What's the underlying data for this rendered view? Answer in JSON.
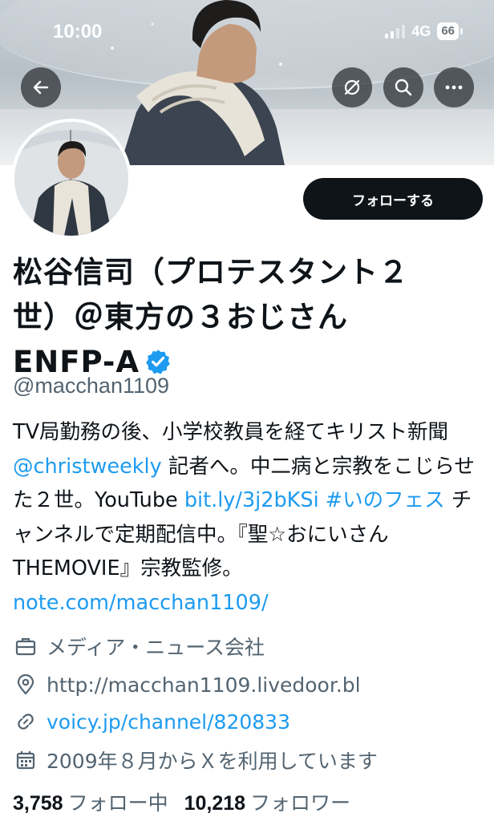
{
  "status_bar": {
    "time": "10:00",
    "network": "4G",
    "battery": "66"
  },
  "banner": {
    "back_icon": "arrow-left-icon",
    "hide_icon": "eye-slash-icon",
    "search_icon": "search-icon",
    "more_icon": "more-horizontal-icon"
  },
  "profile": {
    "follow_label": "フォローする",
    "name_line1": "松谷信司（プロテスタント２",
    "name_line2": "世）＠東方の３おじさん",
    "name_line3": "ENFP-A",
    "handle": "@macchan1109",
    "bio": {
      "t1": "TV局勤務の後、小学校教員を経てキリスト新聞 ",
      "mention": "@christweekly",
      "t2": " 記者へ。中二病と宗教をこじらせた２世。YouTube ",
      "link1": "bit.ly/3j2bKSi",
      "t3": " ",
      "hashtag": "#いのフェス",
      "t4": " チャンネルで定期配信中。『聖☆おにいさん THEMOVIE』宗教監修。",
      "link2": "note.com/macchan1109/"
    },
    "category": "メディア・ニュース会社",
    "location": "http://macchan1109.livedoor.bl",
    "website": "voicy.jp/channel/820833",
    "joined": "2009年８月からＸを利用しています",
    "following_count": "3,758",
    "following_label": "フォロー中",
    "followers_count": "10,218",
    "followers_label": "フォロワー"
  },
  "colors": {
    "link": "#1d9bf0",
    "text": "#0f1419",
    "secondary": "#536471",
    "button": "#0f1419"
  }
}
